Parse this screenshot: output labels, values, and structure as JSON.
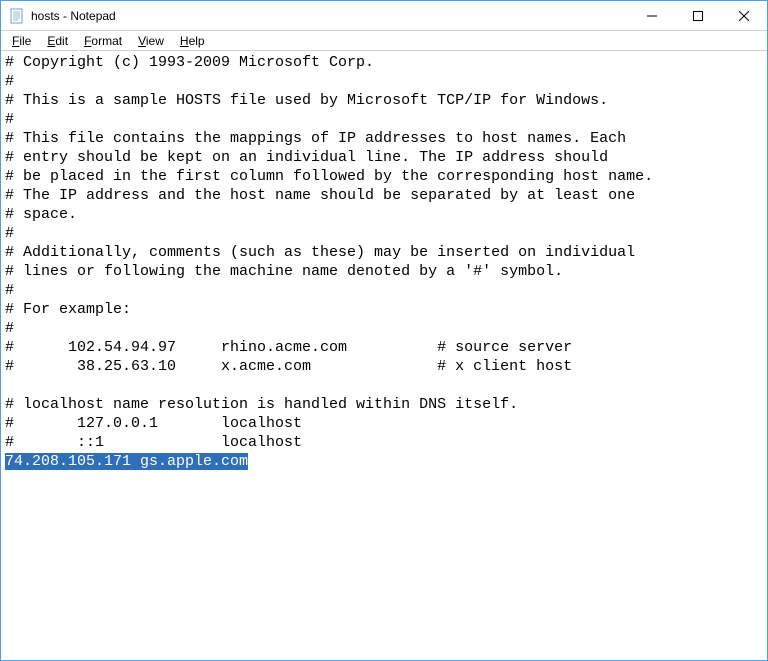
{
  "window": {
    "title": "hosts - Notepad"
  },
  "menubar": {
    "file": "File",
    "edit": "Edit",
    "format": "Format",
    "view": "View",
    "help": "Help"
  },
  "content": {
    "lines": [
      "# Copyright (c) 1993-2009 Microsoft Corp.",
      "#",
      "# This is a sample HOSTS file used by Microsoft TCP/IP for Windows.",
      "#",
      "# This file contains the mappings of IP addresses to host names. Each",
      "# entry should be kept on an individual line. The IP address should",
      "# be placed in the first column followed by the corresponding host name.",
      "# The IP address and the host name should be separated by at least one",
      "# space.",
      "#",
      "# Additionally, comments (such as these) may be inserted on individual",
      "# lines or following the machine name denoted by a '#' symbol.",
      "#",
      "# For example:",
      "#",
      "#      102.54.94.97     rhino.acme.com          # source server",
      "#       38.25.63.10     x.acme.com              # x client host",
      "",
      "# localhost name resolution is handled within DNS itself.",
      "#       127.0.0.1       localhost",
      "#       ::1             localhost"
    ],
    "selected_line": "74.208.105.171 gs.apple.com"
  }
}
